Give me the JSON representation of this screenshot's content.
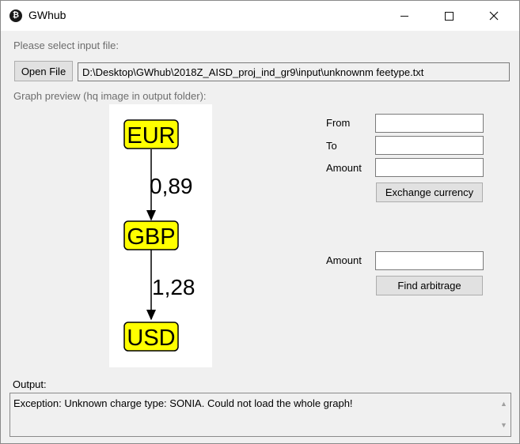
{
  "window": {
    "title": "GWhub",
    "app_icon": "bitcoin-icon",
    "controls": [
      "minimize-icon",
      "maximize-icon",
      "close-icon"
    ]
  },
  "input": {
    "prompt": "Please select input file:",
    "open_button": "Open File",
    "path": "D:\\Desktop\\GWhub\\2018Z_AISD_proj_ind_gr9\\input\\unknownm feetype.txt"
  },
  "graph": {
    "caption": "Graph preview (hq image in output folder):",
    "nodes": [
      "EUR",
      "GBP",
      "USD"
    ],
    "edges": [
      {
        "from": "EUR",
        "to": "GBP",
        "label": "0,89"
      },
      {
        "from": "GBP",
        "to": "USD",
        "label": "1,28"
      }
    ],
    "node_fill": "#ffff00",
    "node_border": "#000000"
  },
  "exchange": {
    "from_label": "From",
    "to_label": "To",
    "amount_label": "Amount",
    "from_value": "",
    "to_value": "",
    "amount_value": "",
    "button": "Exchange currency"
  },
  "arbitrage": {
    "amount_label": "Amount",
    "amount_value": "",
    "button": "Find arbitrage"
  },
  "output": {
    "label": "Output:",
    "text": "Exception: Unknown charge type: SONIA. Could not load the whole graph!"
  }
}
